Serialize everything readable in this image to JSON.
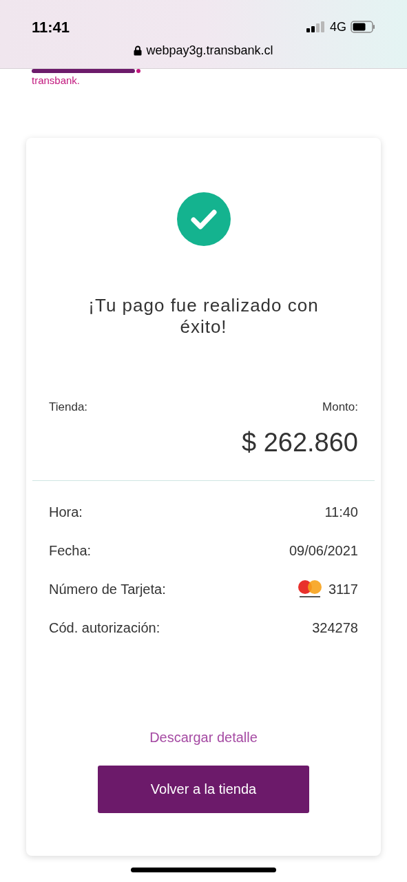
{
  "status_bar": {
    "time": "11:41",
    "network": "4G"
  },
  "address_bar": {
    "url": "webpay3g.transbank.cl"
  },
  "brand": {
    "sub_logo": "transbank."
  },
  "receipt": {
    "title": "¡Tu pago fue realizado con éxito!",
    "store_label": "Tienda:",
    "amount_label": "Monto:",
    "amount": "$ 262.860",
    "rows": [
      {
        "kind": "text",
        "label": "Hora:",
        "value": "11:40"
      },
      {
        "kind": "text",
        "label": "Fecha:",
        "value": "09/06/2021"
      },
      {
        "kind": "card",
        "label": "Número de Tarjeta:",
        "value": "3117"
      },
      {
        "kind": "text",
        "label": "Cód. autorización:",
        "value": "324278"
      }
    ],
    "download_link": "Descargar detalle",
    "return_button": "Volver a la tienda"
  }
}
